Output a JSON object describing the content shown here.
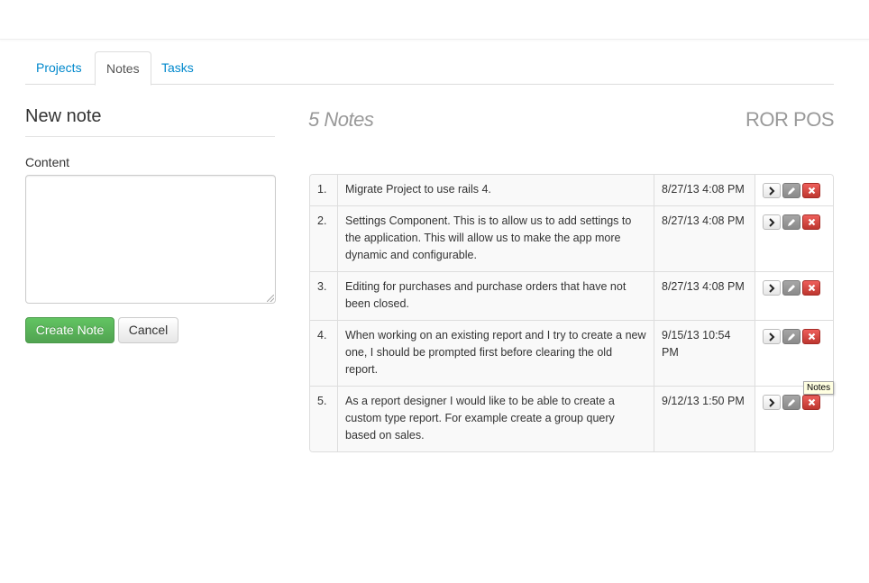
{
  "tabs": [
    {
      "label": "Projects",
      "active": false
    },
    {
      "label": "Notes",
      "active": true
    },
    {
      "label": "Tasks",
      "active": false
    }
  ],
  "form": {
    "title": "New note",
    "content_label": "Content",
    "content_value": "",
    "create_label": "Create Note",
    "cancel_label": "Cancel"
  },
  "list": {
    "heading": "5 Notes",
    "app_name": "ROR POS",
    "rows": [
      {
        "num": "1.",
        "content": "Migrate Project to use rails 4.",
        "date": "8/27/13 4:08 PM"
      },
      {
        "num": "2.",
        "content": "Settings Component. This is to allow us to add settings to the application. This will allow us to make the app more dynamic and configurable.",
        "date": "8/27/13 4:08 PM"
      },
      {
        "num": "3.",
        "content": "Editing for purchases and purchase orders that have not been closed.",
        "date": "8/27/13 4:08 PM"
      },
      {
        "num": "4.",
        "content": "When working on an existing report and I try to create a new one, I should be prompted first before clearing the old report.",
        "date": "9/15/13 10:54 PM"
      },
      {
        "num": "5.",
        "content": "As a report designer I would like to be able to create a custom type report. For example create a group query based on sales.",
        "date": "9/12/13 1:50 PM"
      }
    ],
    "actions": {
      "show": "chevron-right-icon",
      "edit": "pencil-icon",
      "delete": "x-icon"
    }
  },
  "tooltip": {
    "text": "Notes"
  },
  "colors": {
    "link": "#0088cc",
    "success": "#5bb75b",
    "danger": "#da4f49",
    "muted": "#999999"
  }
}
